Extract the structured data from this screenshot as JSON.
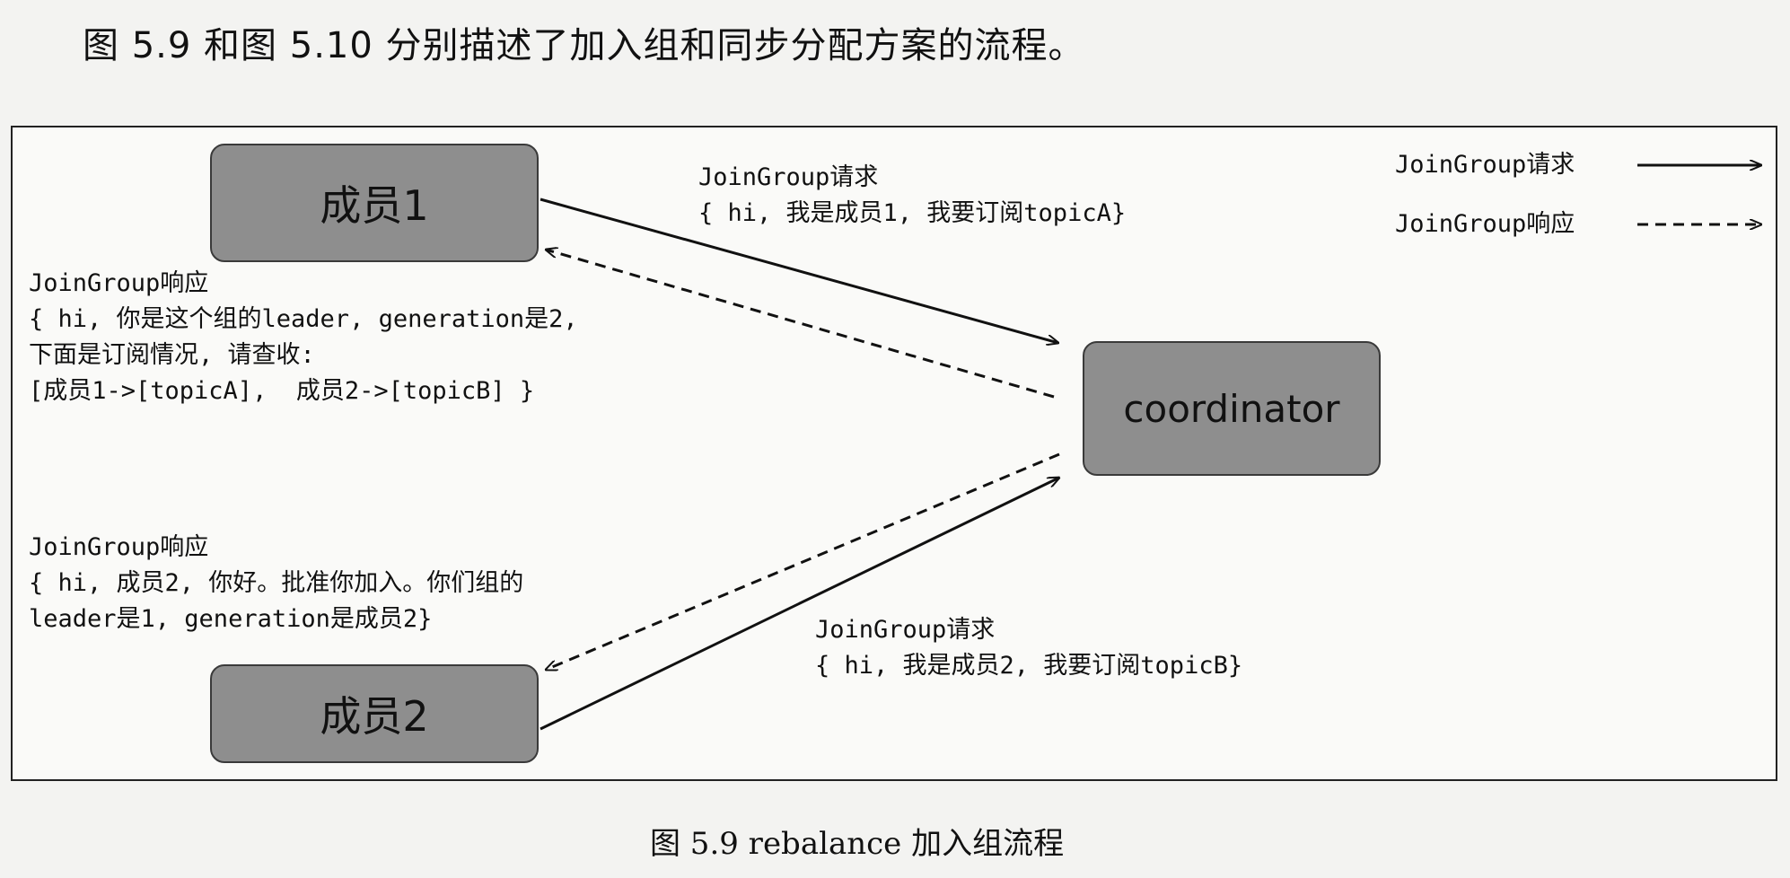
{
  "intro_text": "图 5.9 和图 5.10 分别描述了加入组和同步分配方案的流程。",
  "nodes": {
    "member1": "成员1",
    "member2": "成员2",
    "coordinator": "coordinator"
  },
  "labels": {
    "req1_title": "JoinGroup请求",
    "req1_body": "{ hi, 我是成员1, 我要订阅topicA}",
    "resp1_title": "JoinGroup响应",
    "resp1_line1": "{ hi, 你是这个组的leader, generation是2,",
    "resp1_line2": "下面是订阅情况, 请查收:",
    "resp1_line3": "[成员1->[topicA],  成员2->[topicB] }",
    "resp2_title": "JoinGroup响应",
    "resp2_line1": "{ hi, 成员2, 你好。批准你加入。你们组的",
    "resp2_line2": "leader是1, generation是成员2}",
    "req2_title": "JoinGroup请求",
    "req2_body": "{ hi, 我是成员2, 我要订阅topicB}"
  },
  "legend": {
    "request": "JoinGroup请求",
    "response": "JoinGroup响应"
  },
  "caption": "图 5.9   rebalance 加入组流程"
}
